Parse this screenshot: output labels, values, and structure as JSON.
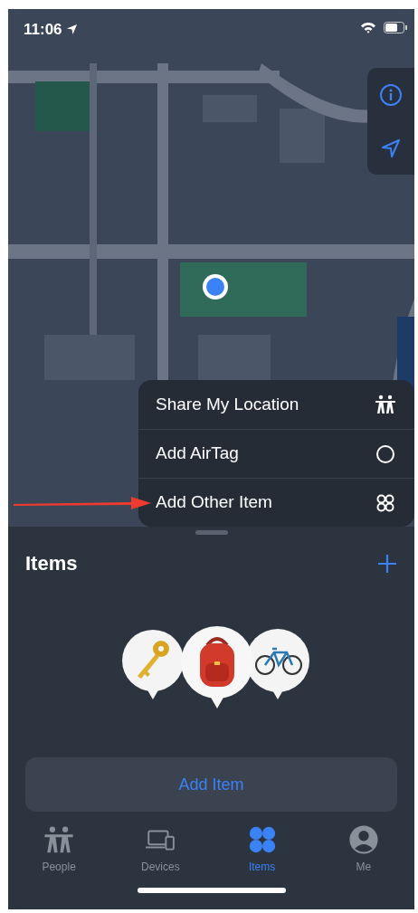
{
  "status_bar": {
    "time": "11:06"
  },
  "menu": {
    "items": [
      {
        "label": "Share My Location",
        "kind": "people"
      },
      {
        "label": "Add AirTag",
        "kind": "circle"
      },
      {
        "label": "Add Other Item",
        "kind": "grid"
      }
    ]
  },
  "sheet": {
    "title": "Items",
    "button": "Add Item"
  },
  "tabs": [
    {
      "label": "People",
      "kind": "people",
      "selected": false
    },
    {
      "label": "Devices",
      "kind": "devices",
      "selected": false
    },
    {
      "label": "Items",
      "kind": "grid",
      "selected": true
    },
    {
      "label": "Me",
      "kind": "person",
      "selected": false
    }
  ]
}
